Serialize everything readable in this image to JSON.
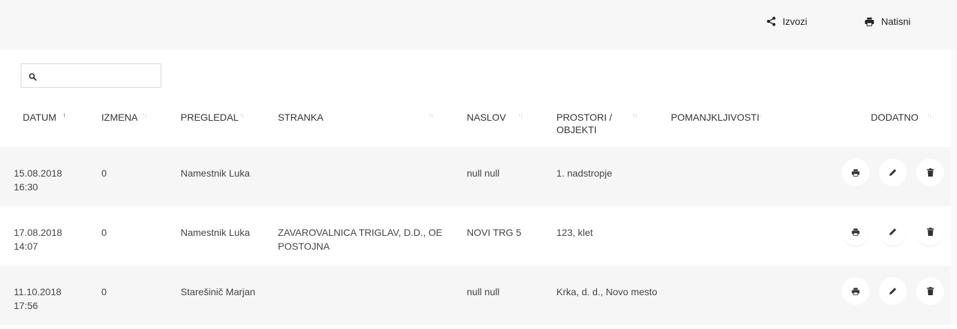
{
  "toolbar": {
    "export_label": "Izvozi",
    "print_label": "Natisni"
  },
  "search": {
    "value": "",
    "placeholder": ""
  },
  "table": {
    "columns": [
      {
        "label": "DATUM",
        "sort": "ascending"
      },
      {
        "label": "IZMENA",
        "sort": "none"
      },
      {
        "label": "PREGLEDAL",
        "sort": "none"
      },
      {
        "label": "STRANKA",
        "sort": "none"
      },
      {
        "label": "NASLOV",
        "sort": "none"
      },
      {
        "label_line1": "PROSTORI /",
        "label_line2": "OBJEKTI",
        "sort": "none"
      },
      {
        "label": "POMANJKLJIVOSTI",
        "sort": "none"
      },
      {
        "label": "DODATNO",
        "sort": "none"
      }
    ],
    "rows": [
      {
        "date": "15.08.2018",
        "time": "16:30",
        "izmena": "0",
        "pregledal": "Namestnik Luka",
        "stranka_line1": "",
        "stranka_line2": "",
        "naslov": "null null",
        "prostori": "1. nadstropje",
        "pomanjkljivosti": ""
      },
      {
        "date": "17.08.2018",
        "time": "14:07",
        "izmena": "0",
        "pregledal": "Namestnik Luka",
        "stranka_line1": "ZAVAROVALNICA TRIGLAV, D.D., OE",
        "stranka_line2": "POSTOJNA",
        "naslov": "NOVI TRG 5",
        "prostori": "123, klet",
        "pomanjkljivosti": ""
      },
      {
        "date": "11.10.2018",
        "time": "17:56",
        "izmena": "0",
        "pregledal": "Starešinič Marjan",
        "stranka_line1": "",
        "stranka_line2": "",
        "naslov": "null null",
        "prostori": "Krka, d. d., Novo mesto",
        "pomanjkljivosti": ""
      }
    ],
    "row_actions": [
      "printer-icon",
      "pencil-icon",
      "trash-icon"
    ]
  },
  "colors": {
    "topbar_bg": "#f7f7f7",
    "row_alt_bg": "#f6f6f6",
    "text": "#333333",
    "sort_inactive": "#c8c8c8"
  }
}
